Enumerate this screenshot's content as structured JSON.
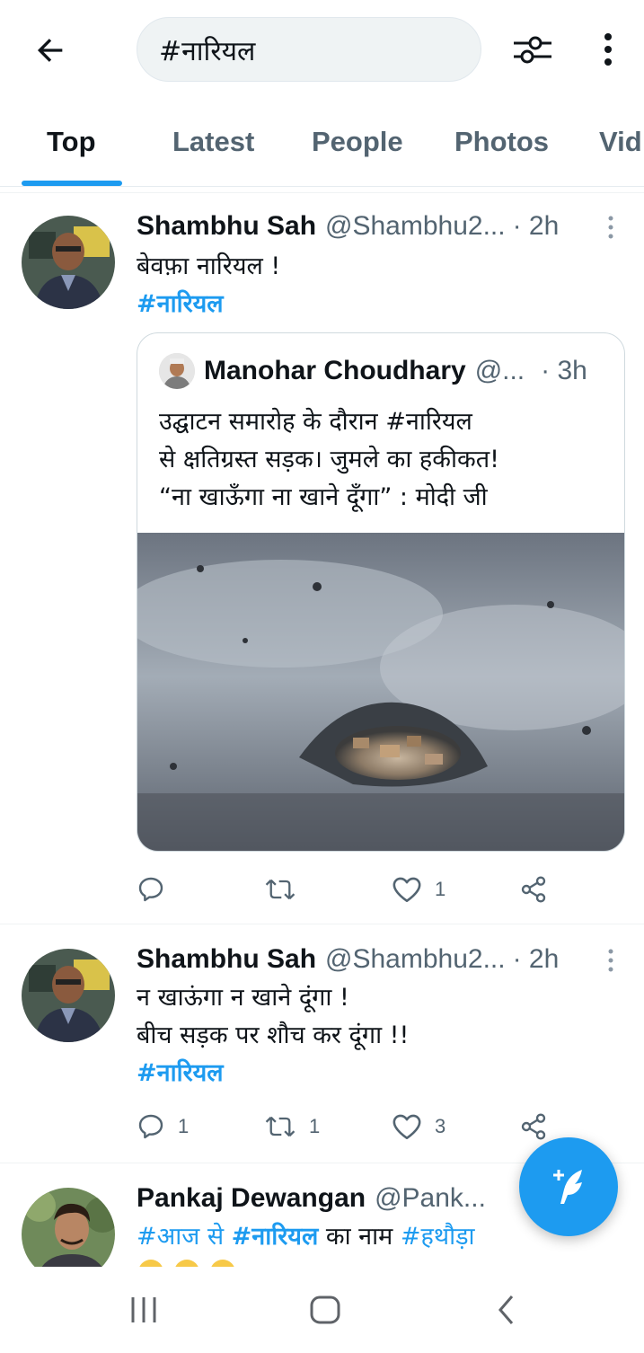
{
  "search": {
    "query": "#नारियल"
  },
  "tabs": [
    {
      "label": "Top"
    },
    {
      "label": "Latest"
    },
    {
      "label": "People"
    },
    {
      "label": "Photos"
    },
    {
      "label": "Vid"
    }
  ],
  "tweets": [
    {
      "name": "Shambhu Sah",
      "handle": "@Shambhu2...",
      "time": "· 2h",
      "lines": [
        "बेवफ़ा नारियल !"
      ],
      "hashtag": "#नारियल",
      "quote": {
        "name": "Manohar Choudhary",
        "handle": "@...",
        "time": "· 3h",
        "line1_pre": "उद्घाटन समारोह के दौरान ",
        "line1_tag": "#नारियल",
        "line2": "से क्षतिग्रस्त सड़क। जुमले का हकीकत!",
        "line3": "“ना खाऊँगा ना खाने दूँगा” : मोदी जी"
      },
      "actions": {
        "replies": "",
        "retweets": "",
        "likes": "1"
      }
    },
    {
      "name": "Shambhu Sah",
      "handle": "@Shambhu2...",
      "time": "· 2h",
      "lines": [
        "न खाऊंगा न खाने दूंगा !",
        "बीच सड़क पर शौच कर दूंगा !!"
      ],
      "hashtag": "#नारियल",
      "actions": {
        "replies": "1",
        "retweets": "1",
        "likes": "3"
      }
    },
    {
      "name": "Pankaj Dewangan",
      "handle": "@Pank...",
      "text_tag1": "#आज से ",
      "text_tag2": "#नारियल",
      "text_mid": " का नाम ",
      "text_tag3": "#हथौड़ा"
    }
  ],
  "colors": {
    "accent": "#1d9bf0",
    "text": "#0f1419",
    "muted": "#536471"
  }
}
